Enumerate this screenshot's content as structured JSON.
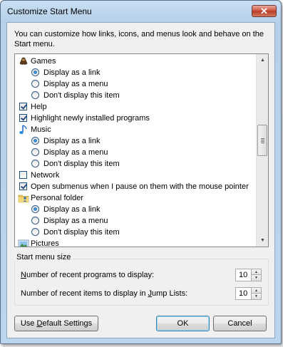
{
  "window": {
    "title": "Customize Start Menu",
    "close_glyph": "✕"
  },
  "intro_text": "You can customize how links, icons, and menus look and behave on the Start menu.",
  "list": [
    {
      "kind": "header",
      "icon": "games-icon",
      "label": "Games"
    },
    {
      "kind": "radio",
      "label": "Display as a link",
      "checked": true
    },
    {
      "kind": "radio",
      "label": "Display as a menu",
      "checked": false
    },
    {
      "kind": "radio",
      "label": "Don't display this item",
      "checked": false
    },
    {
      "kind": "checkbox",
      "label": "Help",
      "checked": true
    },
    {
      "kind": "checkbox",
      "label": "Highlight newly installed programs",
      "checked": true
    },
    {
      "kind": "header",
      "icon": "music-icon",
      "label": "Music"
    },
    {
      "kind": "radio",
      "label": "Display as a link",
      "checked": true
    },
    {
      "kind": "radio",
      "label": "Display as a menu",
      "checked": false
    },
    {
      "kind": "radio",
      "label": "Don't display this item",
      "checked": false
    },
    {
      "kind": "checkbox",
      "label": "Network",
      "checked": false
    },
    {
      "kind": "checkbox",
      "label": "Open submenus when I pause on them with the mouse pointer",
      "checked": true
    },
    {
      "kind": "header",
      "icon": "personal-folder-icon",
      "label": "Personal folder"
    },
    {
      "kind": "radio",
      "label": "Display as a link",
      "checked": true
    },
    {
      "kind": "radio",
      "label": "Display as a menu",
      "checked": false
    },
    {
      "kind": "radio",
      "label": "Don't display this item",
      "checked": false
    },
    {
      "kind": "header",
      "icon": "pictures-icon",
      "label": "Pictures"
    }
  ],
  "start_menu_size": {
    "title": "Start menu size",
    "recent_programs": {
      "label_pre": "",
      "label_key": "N",
      "label_post": "umber of recent programs to display:",
      "value": "10"
    },
    "recent_items": {
      "label_pre": "Number of recent items to display in ",
      "label_key": "J",
      "label_post": "ump Lists:",
      "value": "10"
    }
  },
  "buttons": {
    "default_settings": {
      "pre": "Use ",
      "key": "D",
      "post": "efault Settings"
    },
    "ok": "OK",
    "cancel": "Cancel"
  }
}
